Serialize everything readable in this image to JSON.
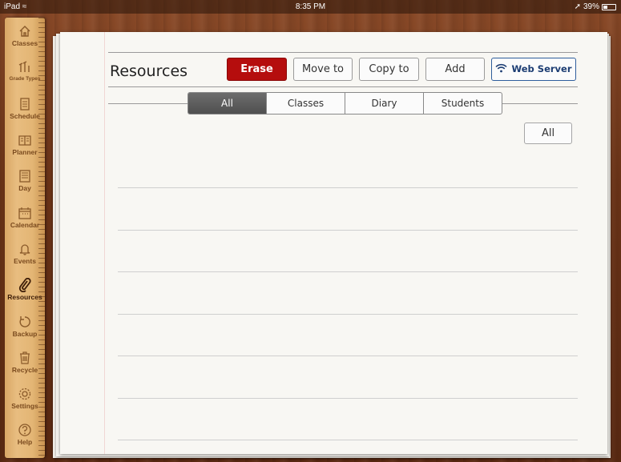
{
  "status_bar": {
    "device": "iPad",
    "time": "8:35 PM",
    "battery": "39%"
  },
  "sidebar": {
    "items": [
      {
        "label": "Classes",
        "icon": "home-icon"
      },
      {
        "label": "Grade Types",
        "icon": "grade-types-icon"
      },
      {
        "label": "Schedule",
        "icon": "schedule-icon"
      },
      {
        "label": "Planner",
        "icon": "planner-icon"
      },
      {
        "label": "Day",
        "icon": "day-icon"
      },
      {
        "label": "Calendar",
        "icon": "calendar-icon"
      },
      {
        "label": "Events",
        "icon": "bell-icon"
      },
      {
        "label": "Resources",
        "icon": "paperclip-icon",
        "active": true
      },
      {
        "label": "Backup",
        "icon": "backup-icon"
      },
      {
        "label": "Recycle",
        "icon": "trash-icon"
      },
      {
        "label": "Settings",
        "icon": "gear-icon"
      },
      {
        "label": "Help",
        "icon": "help-icon"
      }
    ]
  },
  "header": {
    "title": "Resources",
    "buttons": {
      "erase": "Erase",
      "move_to": "Move to",
      "copy_to": "Copy to",
      "add": "Add",
      "web_server": "Web Server"
    }
  },
  "segments": [
    "All",
    "Classes",
    "Diary",
    "Students"
  ],
  "selected_segment": "All",
  "filter_button": "All",
  "colors": {
    "erase": "#b50d0d",
    "accent": "#1c3d73"
  }
}
